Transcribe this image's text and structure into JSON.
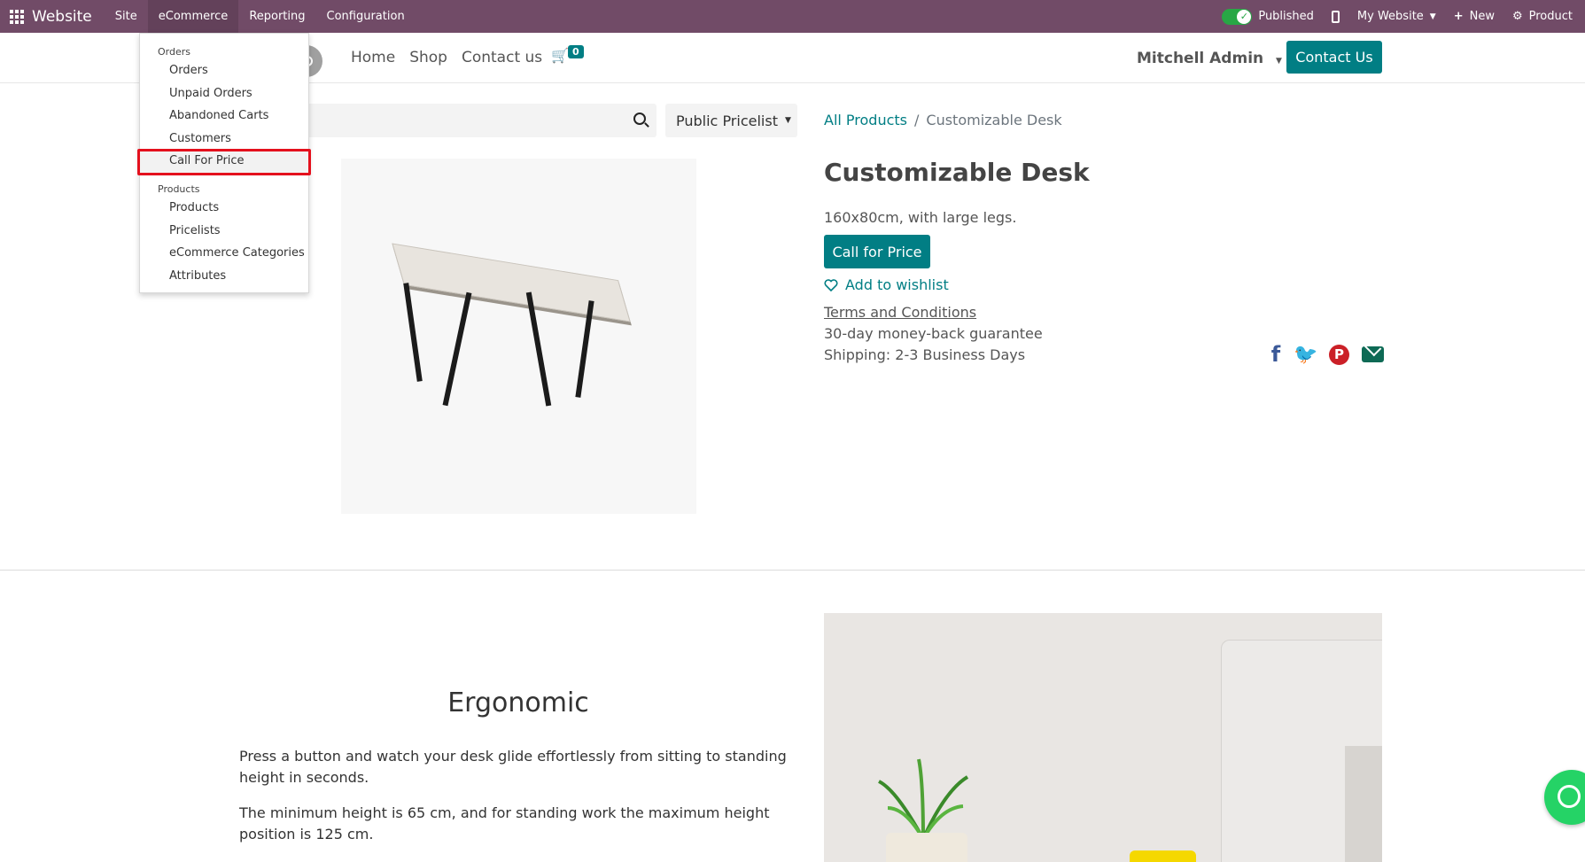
{
  "topbar": {
    "brand": "Website",
    "menus": [
      "Site",
      "eCommerce",
      "Reporting",
      "Configuration"
    ],
    "published_label": "Published",
    "my_website_label": "My Website",
    "new_label": "New",
    "product_label": "Product"
  },
  "header": {
    "nav": [
      "Home",
      "Shop",
      "Contact us"
    ],
    "cart_count": "0",
    "user_name": "Mitchell Admin",
    "contact_button": "Contact Us"
  },
  "search": {
    "pricelist_label": "Public Pricelist"
  },
  "breadcrumb": {
    "parent": "All Products",
    "separator": "/",
    "current": "Customizable Desk"
  },
  "product": {
    "title": "Customizable Desk",
    "description": "160x80cm, with large legs.",
    "call_button": "Call for Price",
    "wishlist_label": "Add to wishlist",
    "terms": "Terms and Conditions",
    "guarantee": "30-day money-back guarantee",
    "shipping": "Shipping: 2-3 Business Days"
  },
  "section": {
    "title": "Ergonomic",
    "paragraph_1": "Press a button and watch your desk glide effortlessly from sitting to standing height in seconds.",
    "paragraph_2": "The minimum height is 65 cm, and for standing work the maximum height position is 125 cm."
  },
  "dropdown": {
    "orders_header": "Orders",
    "orders_items": [
      "Orders",
      "Unpaid Orders",
      "Abandoned Carts",
      "Customers",
      "Call For Price"
    ],
    "products_header": "Products",
    "products_items": [
      "Products",
      "Pricelists",
      "eCommerce Categories",
      "Attributes"
    ]
  },
  "colors": {
    "admin_bar": "#714B67",
    "accent": "#017e84",
    "highlight_border": "#e4101d"
  },
  "icons": [
    "apps-grid-icon",
    "toggle-check-icon",
    "mobile-icon",
    "plus-icon",
    "gear-icon",
    "cart-icon",
    "search-icon",
    "heart-icon",
    "facebook-icon",
    "twitter-icon",
    "pinterest-icon",
    "email-icon",
    "whatsapp-icon"
  ]
}
